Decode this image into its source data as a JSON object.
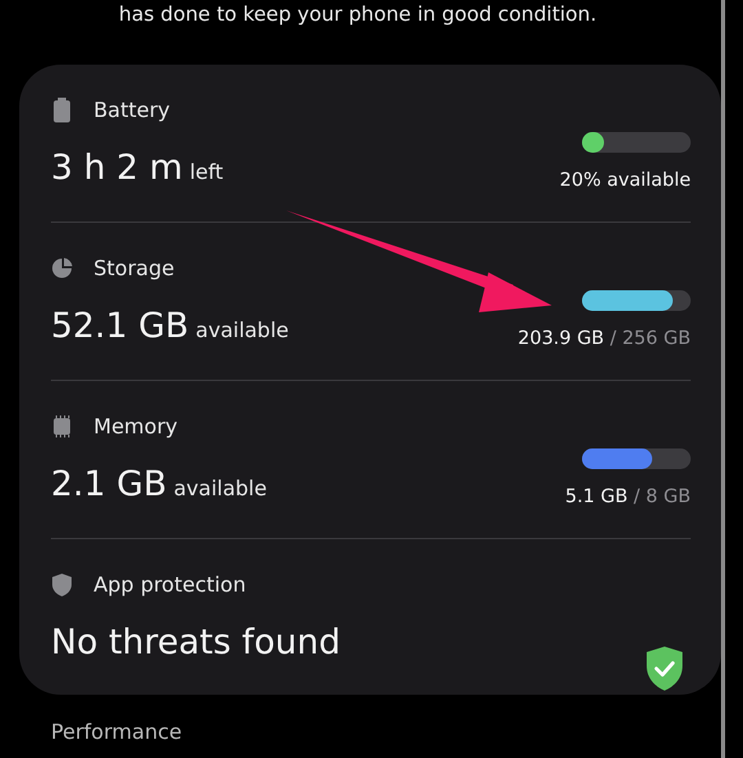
{
  "intro_text": "has done to keep your phone in good condition.",
  "sections": [
    {
      "kind": "meter",
      "title": "Battery",
      "value": "3 h 2 m",
      "unit": "left",
      "level": 0.2,
      "color": "#5fd068",
      "reading": "20% available"
    },
    {
      "kind": "meter",
      "title": "Storage",
      "value": "52.1 GB",
      "unit": "available",
      "level": 0.83,
      "color": "#5bc3e0",
      "reading": "**203.9 GB** / 256 GB"
    },
    {
      "kind": "meter",
      "title": "Memory",
      "value": "2.1 GB",
      "unit": "available",
      "level": 0.64,
      "color": "#4f7df0",
      "reading": "**5.1 GB** / 8 GB"
    },
    {
      "kind": "status",
      "title": "App protection",
      "value": "No threats found",
      "safe": true
    }
  ],
  "next_section": "Performance"
}
